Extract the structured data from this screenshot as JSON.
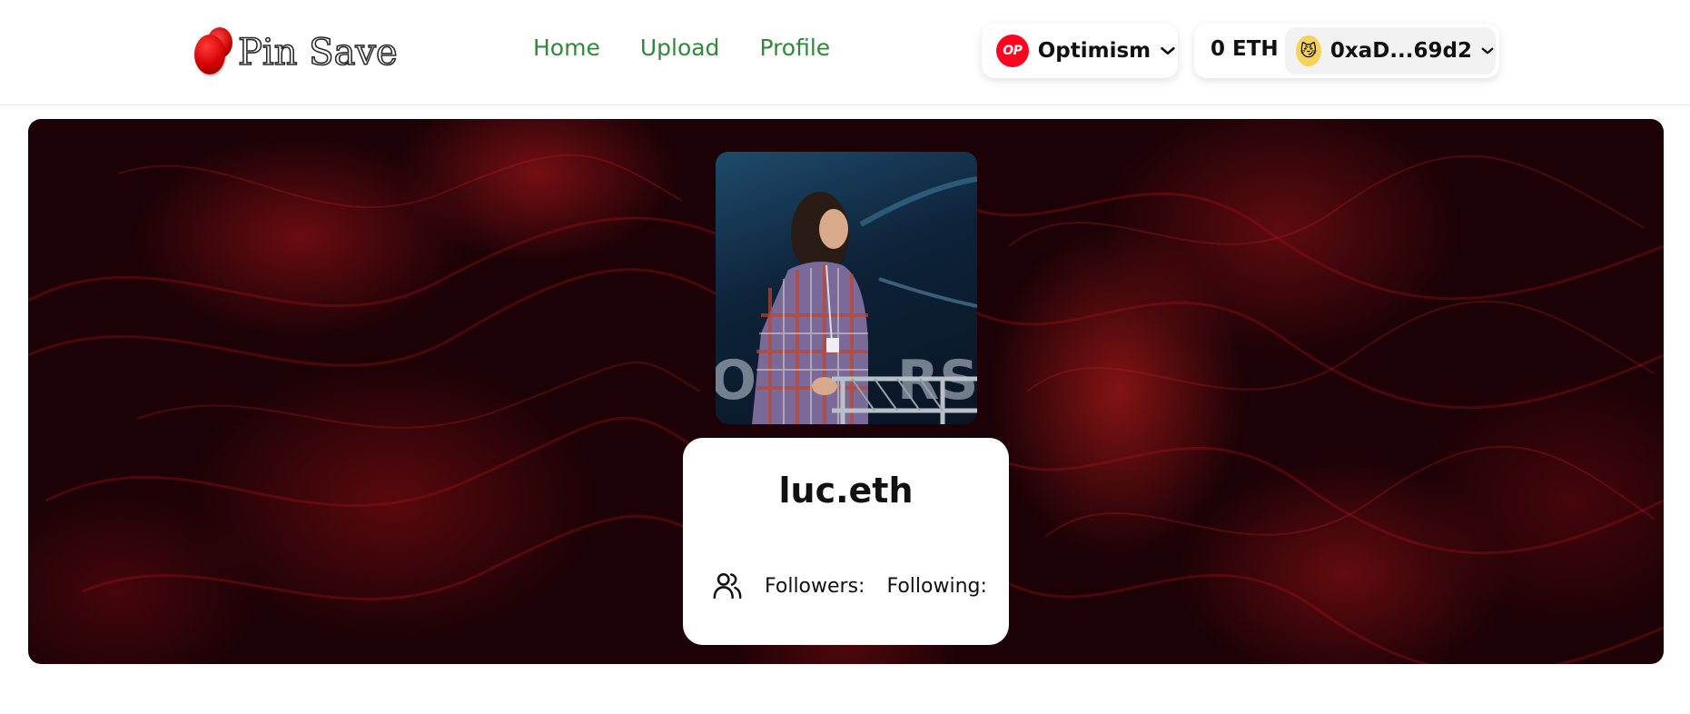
{
  "header": {
    "logo_text": "Pin Save",
    "nav": [
      {
        "label": "Home"
      },
      {
        "label": "Upload"
      },
      {
        "label": "Profile"
      }
    ],
    "network": {
      "icon_text": "OP",
      "label": "Optimism",
      "icon_color": "#ff0420"
    },
    "account": {
      "balance": "0 ETH",
      "address": "0xaD...69d2",
      "avatar_icon": "cat-face-emoji"
    }
  },
  "profile": {
    "name": "luc.eth",
    "followers_label": "Followers:",
    "following_label": "Following:"
  },
  "colors": {
    "nav_link": "#2e8a3a",
    "banner_base": "#1c0206",
    "banner_accent": "#b01218"
  }
}
